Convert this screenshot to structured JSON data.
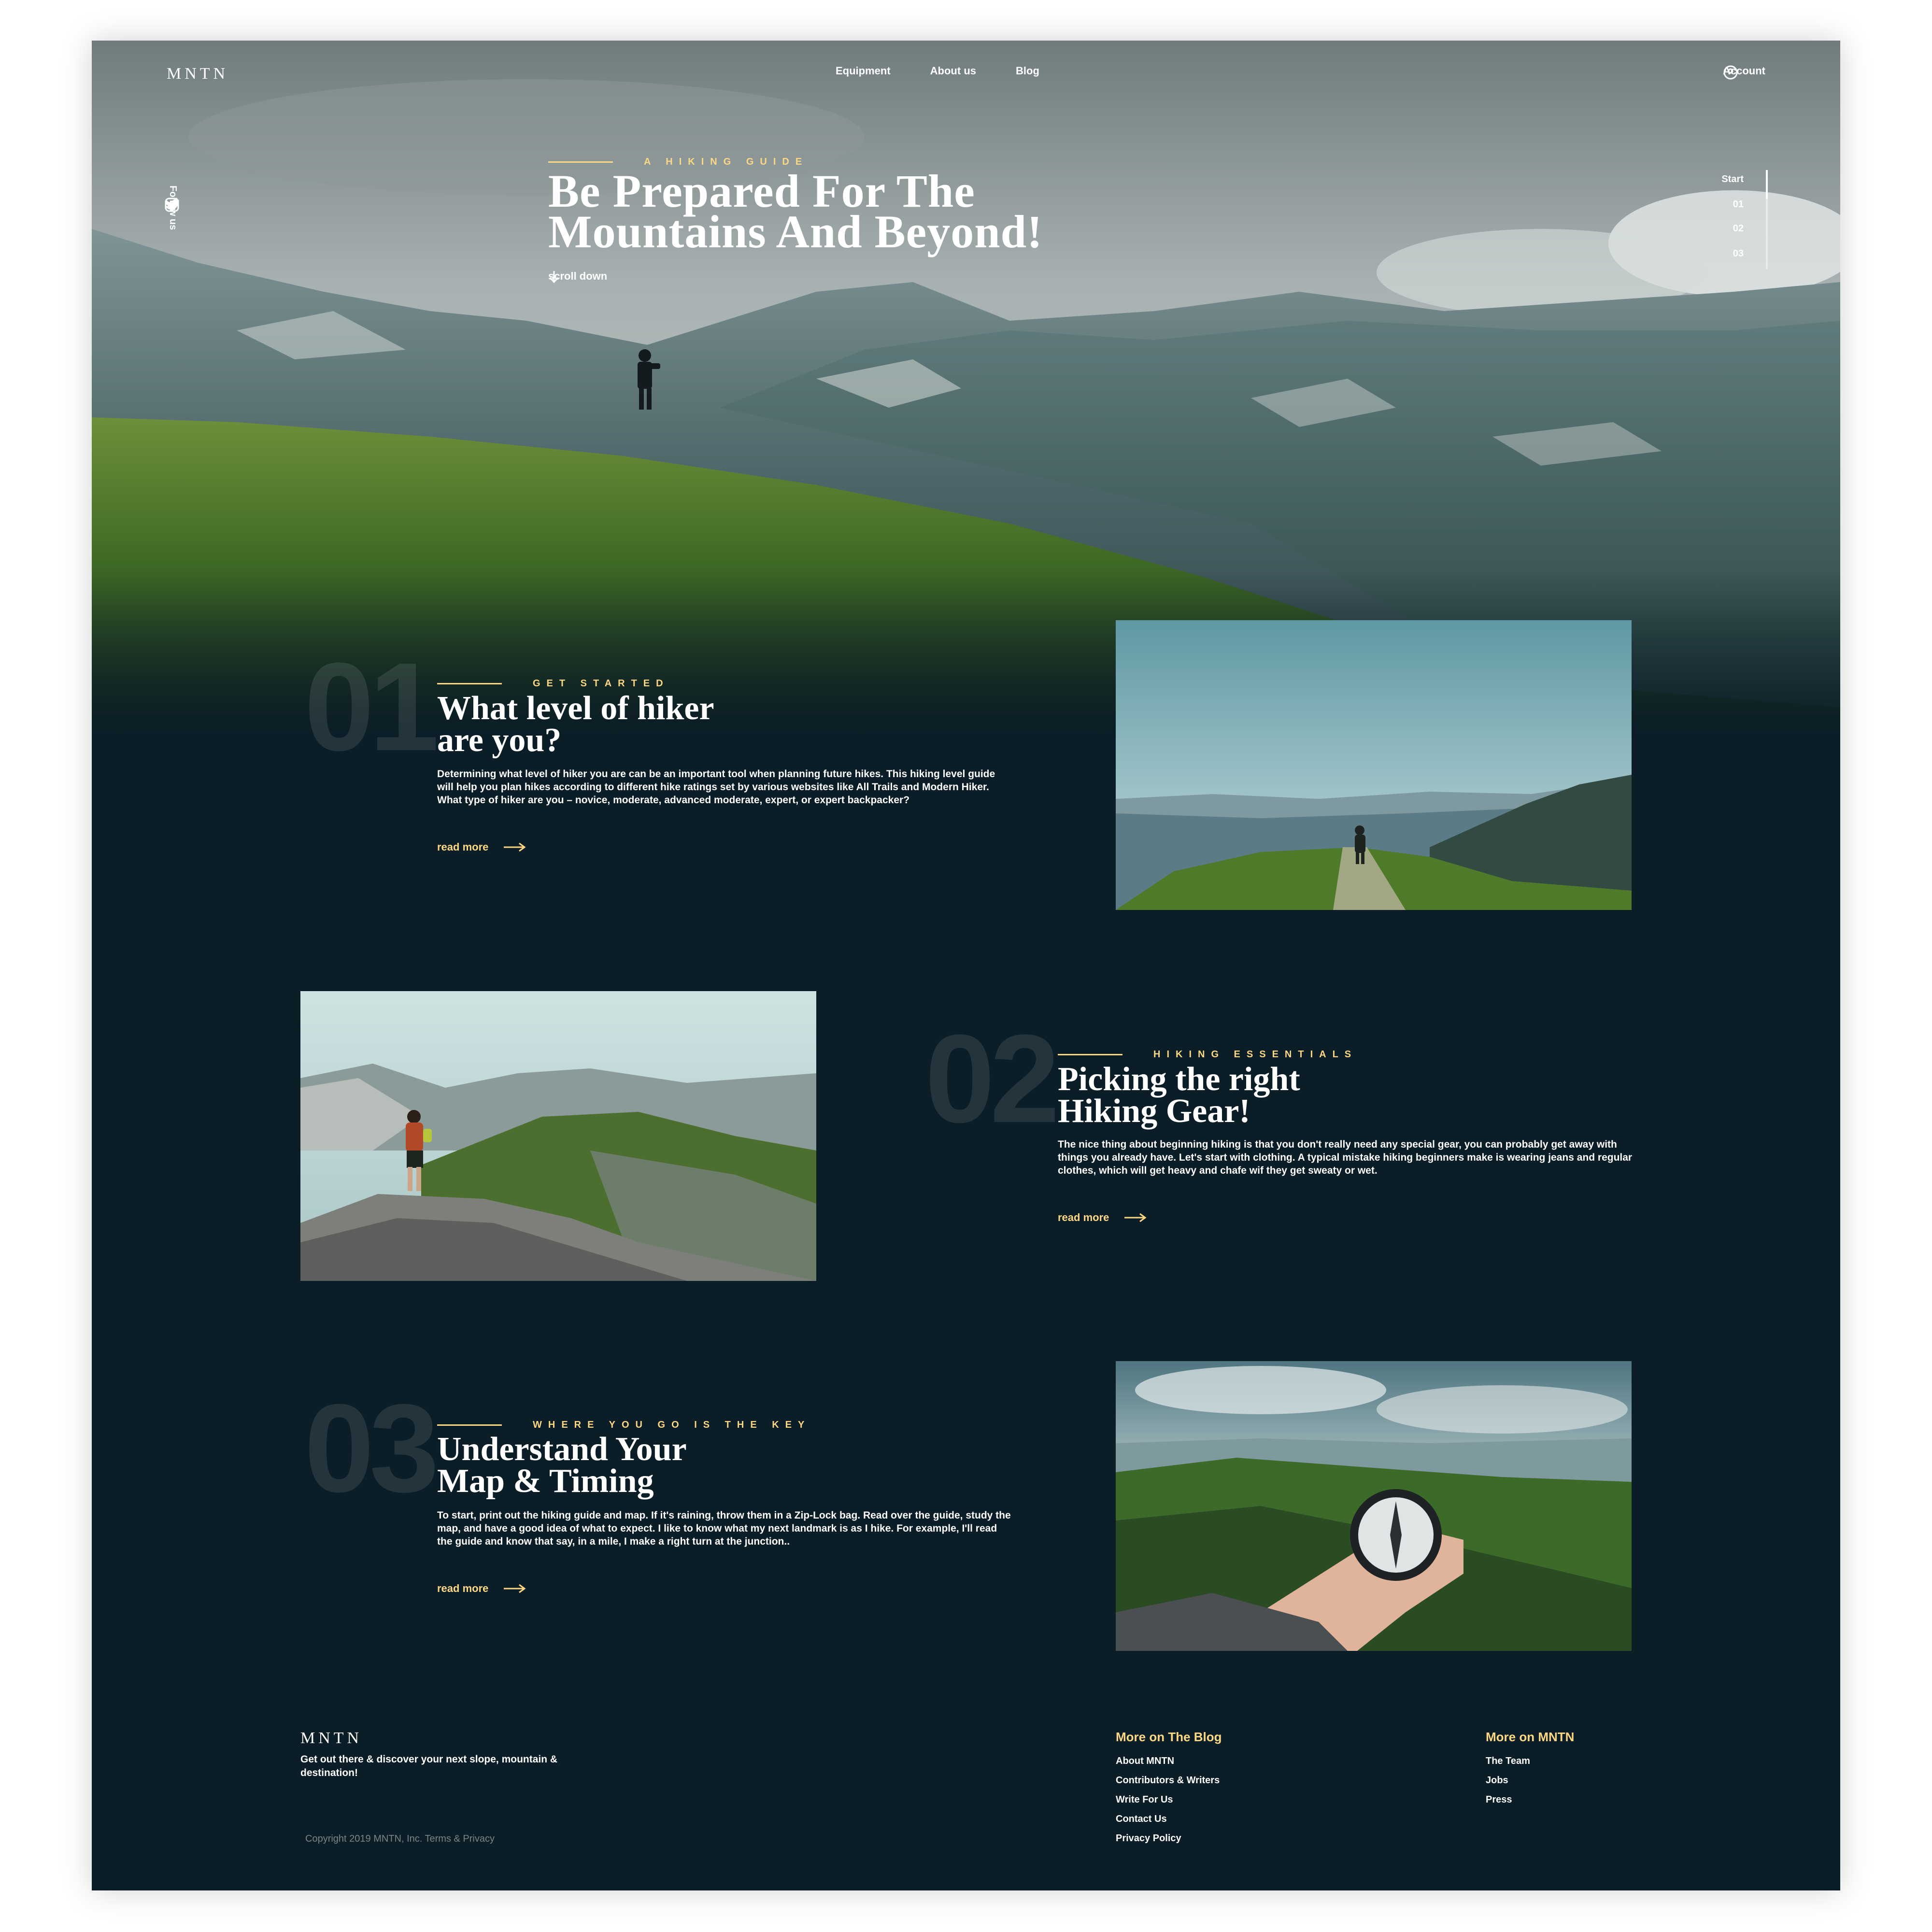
{
  "header": {
    "logo": "MNTN",
    "nav": [
      "Equipment",
      "About us",
      "Blog"
    ],
    "account": "Account"
  },
  "hero": {
    "follow": "Follow us",
    "eyebrow": "A HIKING GUIDE",
    "title_line1": "Be Prepared For The",
    "title_line2": "Mountains And Beyond!",
    "scroll": "scroll down",
    "slider": [
      "Start",
      "01",
      "02",
      "03"
    ]
  },
  "sections": [
    {
      "num": "01",
      "eyebrow": "GET STARTED",
      "title_line1": "What level of  hiker",
      "title_line2": "are you?",
      "body": "Determining what level of hiker you are can be an important tool when planning future hikes. This hiking level guide will help you plan hikes according to different hike ratings set by various websites like All Trails and Modern Hiker. What type of hiker are you – novice, moderate, advanced moderate, expert, or expert backpacker?",
      "cta": "read more"
    },
    {
      "num": "02",
      "eyebrow": "HIKING ESSENTIALS",
      "title_line1": "Picking the right",
      "title_line2": "Hiking Gear!",
      "body": "The nice thing about beginning hiking is that you don't really need any special gear, you can probably get away with things you already have. Let's start with clothing. A typical mistake hiking beginners make is wearing jeans and regular clothes, which will get heavy and chafe wif they get sweaty or wet.",
      "cta": "read more"
    },
    {
      "num": "03",
      "eyebrow": "WHERE YOU GO IS THE KEY",
      "title_line1": "Understand Your",
      "title_line2": "Map & Timing",
      "body": "To start, print out the hiking guide and map. If it's raining, throw them in a Zip-Lock bag. Read over the guide, study the map, and have a good idea of what to expect. I like to know what my next landmark is as I hike. For example, I'll read the guide and know that say, in a mile, I make a right turn at the junction..",
      "cta": "read more"
    }
  ],
  "footer": {
    "logo": "MNTN",
    "tagline": "Get out there & discover your next slope, mountain & destination!",
    "copyright": "Copyright 2019 MNTN, Inc. Terms & Privacy",
    "col1": {
      "title": "More on The Blog",
      "links": [
        "About MNTN",
        "Contributors & Writers",
        "Write For Us",
        "Contact Us",
        "Privacy Policy"
      ]
    },
    "col2": {
      "title": "More on MNTN",
      "links": [
        "The Team",
        "Jobs",
        "Press"
      ]
    }
  },
  "colors": {
    "background": "#0b1d26",
    "accent": "#fbd784",
    "text": "#ffffff"
  },
  "icons": [
    "user-circle-icon",
    "instagram-icon",
    "twitter-icon",
    "arrow-down-icon",
    "arrow-right-icon"
  ]
}
